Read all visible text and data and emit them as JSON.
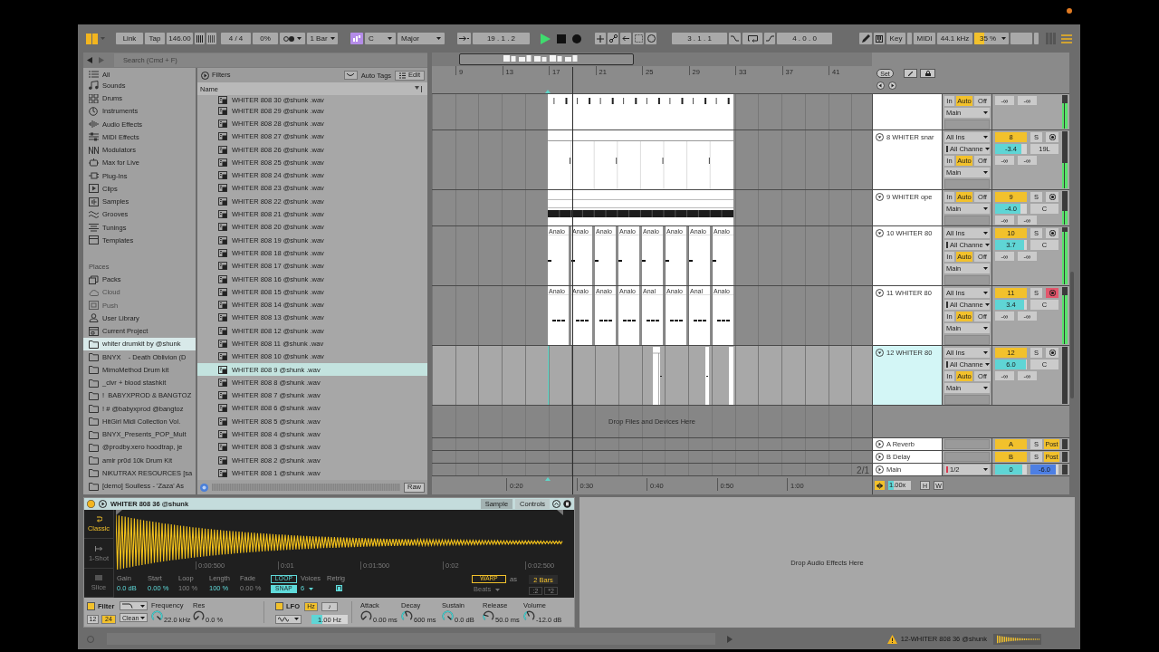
{
  "transport": {
    "link": "Link",
    "tap": "Tap",
    "tempo": "146.00",
    "time_signature": "4 / 4",
    "groove": "0%",
    "quantize": "1 Bar",
    "scale": {
      "on": true,
      "root": "C",
      "mode": "Major"
    },
    "position": "19 . 1 . 2",
    "playing": true,
    "loop_start": "3 . 1 . 1",
    "loop_length": "4 . 0 . 0",
    "key": "Key",
    "midi": "MIDI",
    "sample_rate": "44.1 kHz",
    "cpu": {
      "reading": "35 %",
      "level": 0.3
    }
  },
  "browser": {
    "search": {
      "placeholder": "Search (Cmd + F)"
    },
    "categories": [
      {
        "label": "All"
      },
      {
        "label": "Sounds"
      },
      {
        "label": "Drums"
      },
      {
        "label": "Instruments"
      },
      {
        "label": "Audio Effects"
      },
      {
        "label": "MIDI Effects"
      },
      {
        "label": "Modulators"
      },
      {
        "label": "Max for Live"
      },
      {
        "label": "Plug-Ins"
      },
      {
        "label": "Clips"
      },
      {
        "label": "Samples"
      },
      {
        "label": "Grooves"
      },
      {
        "label": "Tunings"
      },
      {
        "label": "Templates"
      }
    ],
    "places_heading": "Places",
    "places": [
      {
        "label": "Packs",
        "kind": "packs",
        "disabled": false,
        "selected": false
      },
      {
        "label": "Cloud",
        "kind": "cloud",
        "disabled": true,
        "selected": false
      },
      {
        "label": "Push",
        "kind": "push",
        "disabled": true,
        "selected": false
      },
      {
        "label": "User Library",
        "kind": "library",
        "disabled": false,
        "selected": false
      },
      {
        "label": "Current Project",
        "kind": "project",
        "disabled": false,
        "selected": false
      },
      {
        "label": "whiter drumkit by @shunk",
        "kind": "folder",
        "disabled": false,
        "selected": true
      },
      {
        "label": "BNYX    - Death Oblivion (D",
        "kind": "folder",
        "disabled": false,
        "selected": false
      },
      {
        "label": "MimoMethod Drum kit",
        "kind": "folder",
        "disabled": false,
        "selected": false
      },
      {
        "label": "_clvr + blood stashkit",
        "kind": "folder",
        "disabled": false,
        "selected": false
      },
      {
        "label": "!  BABYXPROD & BANGTOZ",
        "kind": "folder",
        "disabled": false,
        "selected": false
      },
      {
        "label": "! # @babyxprod @bangtoz",
        "kind": "folder",
        "disabled": false,
        "selected": false
      },
      {
        "label": "HitGirl Midi Collection Vol.",
        "kind": "folder",
        "disabled": false,
        "selected": false
      },
      {
        "label": "BNYX_Presents_POP_Mult",
        "kind": "folder",
        "disabled": false,
        "selected": false
      },
      {
        "label": "@prodby.xero hoodtrap, je",
        "kind": "folder",
        "disabled": false,
        "selected": false
      },
      {
        "label": "amir pr0d 10k Drum Kit",
        "kind": "folder",
        "disabled": false,
        "selected": false
      },
      {
        "label": "NiKUTRAX RESOURCES [sa",
        "kind": "folder",
        "disabled": false,
        "selected": false
      },
      {
        "label": "[demo] Soulless - 'Zaza' As",
        "kind": "folder",
        "disabled": false,
        "selected": false
      }
    ],
    "filters": "Filters",
    "auto_tags": {
      "label": "Auto Tags",
      "on": false
    },
    "edit": "Edit",
    "column": "Name",
    "files": [
      {
        "name": "WHITER 808 30 @shunk .wav",
        "selected": false
      },
      {
        "name": "WHITER 808 29 @shunk .wav",
        "selected": false
      },
      {
        "name": "WHITER 808 28 @shunk .wav",
        "selected": false
      },
      {
        "name": "WHITER 808 27 @shunk .wav",
        "selected": false
      },
      {
        "name": "WHITER 808 26 @shunk .wav",
        "selected": false
      },
      {
        "name": "WHITER 808 25 @shunk .wav",
        "selected": false
      },
      {
        "name": "WHITER 808 24 @shunk .wav",
        "selected": false
      },
      {
        "name": "WHITER 808 23 @shunk .wav",
        "selected": false
      },
      {
        "name": "WHITER 808 22 @shunk .wav",
        "selected": false
      },
      {
        "name": "WHITER 808 21 @shunk .wav",
        "selected": false
      },
      {
        "name": "WHITER 808 20 @shunk .wav",
        "selected": false
      },
      {
        "name": "WHITER 808 19 @shunk .wav",
        "selected": false
      },
      {
        "name": "WHITER 808 18 @shunk .wav",
        "selected": false
      },
      {
        "name": "WHITER 808 17 @shunk .wav",
        "selected": false
      },
      {
        "name": "WHITER 808 16 @shunk .wav",
        "selected": false
      },
      {
        "name": "WHITER 808 15 @shunk .wav",
        "selected": false
      },
      {
        "name": "WHITER 808 14 @shunk .wav",
        "selected": false
      },
      {
        "name": "WHITER 808 13 @shunk .wav",
        "selected": false
      },
      {
        "name": "WHITER 808 12 @shunk .wav",
        "selected": false
      },
      {
        "name": "WHITER 808 11 @shunk .wav",
        "selected": false
      },
      {
        "name": "WHITER 808 10 @shunk .wav",
        "selected": false
      },
      {
        "name": "WHITER 808 9 @shunk .wav",
        "selected": true
      },
      {
        "name": "WHITER 808 8 @shunk .wav",
        "selected": false
      },
      {
        "name": "WHITER 808 7 @shunk .wav",
        "selected": false
      },
      {
        "name": "WHITER 808 6 @shunk .wav",
        "selected": false
      },
      {
        "name": "WHITER 808 5 @shunk .wav",
        "selected": false
      },
      {
        "name": "WHITER 808 4 @shunk .wav",
        "selected": false
      },
      {
        "name": "WHITER 808 3 @shunk .wav",
        "selected": false
      },
      {
        "name": "WHITER 808 2 @shunk .wav",
        "selected": false
      },
      {
        "name": "WHITER 808 1 @shunk .wav",
        "selected": false
      }
    ],
    "raw": "Raw"
  },
  "arrangement": {
    "set": "Set",
    "bars": [
      "9",
      "13",
      "17",
      "21",
      "25",
      "29",
      "33",
      "37",
      "41"
    ],
    "tracks": [
      {
        "selected": false,
        "monitor": [
          {
            "label": "In",
            "selected": false
          },
          {
            "label": "Auto",
            "selected": true
          },
          {
            "label": "Off",
            "selected": false
          }
        ],
        "output": "Main",
        "peaks": [
          "-∞",
          "-∞"
        ],
        "meter": {
          "level": 0.75
        },
        "lane": {
          "kind": "hits"
        }
      },
      {
        "name": "8 WHITER snar",
        "number": "8",
        "solo": "S",
        "armed": false,
        "selected": false,
        "input": "All Ins",
        "channel": "All Channe",
        "monitor": [
          {
            "label": "In",
            "selected": false
          },
          {
            "label": "Auto",
            "selected": true
          },
          {
            "label": "Off",
            "selected": false
          }
        ],
        "output": "Main",
        "volume": {
          "reading": "-3.4",
          "level": 0.82
        },
        "pan": "19L",
        "peaks": [
          "-∞",
          "-∞"
        ],
        "meter": {
          "level": 0.45
        },
        "lane": {
          "kind": "sparse"
        }
      },
      {
        "name": "9 WHITER ope",
        "number": "9",
        "solo": "S",
        "armed": false,
        "selected": false,
        "monitor": [
          {
            "label": "In",
            "selected": false
          },
          {
            "label": "Auto",
            "selected": true
          },
          {
            "label": "Off",
            "selected": false
          }
        ],
        "output": "Main",
        "volume": {
          "reading": "-4.0",
          "level": 0.8
        },
        "pan": "C",
        "peaks": [
          "-∞",
          "-∞"
        ],
        "meter": {
          "level": 0.4
        },
        "lane": {
          "kind": "bar"
        }
      },
      {
        "name": "10 WHITER 80",
        "number": "10",
        "solo": "S",
        "armed": false,
        "selected": false,
        "input": "All Ins",
        "channel": "All Channe",
        "monitor": [
          {
            "label": "In",
            "selected": false
          },
          {
            "label": "Auto",
            "selected": true
          },
          {
            "label": "Off",
            "selected": false
          }
        ],
        "output": "Main",
        "volume": {
          "reading": "3.7",
          "level": 0.92
        },
        "pan": "C",
        "peaks": [
          "-∞",
          "-∞"
        ],
        "meter": {
          "level": 0.92
        },
        "lane": {
          "kind": "note-clips",
          "clips": [
            {
              "name": "Analo"
            },
            {
              "name": "Analo"
            },
            {
              "name": "Analo"
            },
            {
              "name": "Analo"
            },
            {
              "name": "Analo"
            },
            {
              "name": "Analo"
            },
            {
              "name": "Analo"
            },
            {
              "name": "Analo"
            }
          ]
        }
      },
      {
        "name": "11 WHITER 80",
        "number": "11",
        "solo": "S",
        "armed": true,
        "selected": false,
        "input": "All Ins",
        "channel": "All Channe",
        "monitor": [
          {
            "label": "In",
            "selected": false
          },
          {
            "label": "Auto",
            "selected": true
          },
          {
            "label": "Off",
            "selected": false
          }
        ],
        "output": "Main",
        "volume": {
          "reading": "3.4",
          "level": 0.9
        },
        "pan": "C",
        "peaks": [
          "-∞",
          "-∞"
        ],
        "meter": {
          "level": 0.85
        },
        "lane": {
          "kind": "chord-clips",
          "clips": [
            {
              "name": "Analo"
            },
            {
              "name": "Analo"
            },
            {
              "name": "Analo"
            },
            {
              "name": "Analo"
            },
            {
              "name": "Anal"
            },
            {
              "name": "Analo"
            },
            {
              "name": "Anal"
            },
            {
              "name": "Analo"
            }
          ]
        }
      },
      {
        "name": "12 WHITER 80",
        "number": "12",
        "solo": "S",
        "armed": false,
        "selected": true,
        "input": "All Ins",
        "channel": "All Channe",
        "monitor": [
          {
            "label": "In",
            "selected": false
          },
          {
            "label": "Auto",
            "selected": true
          },
          {
            "label": "Off",
            "selected": false
          }
        ],
        "output": "Main",
        "volume": {
          "reading": "6.0",
          "level": 0.96
        },
        "pan": "C",
        "peaks": [
          "-∞",
          "-∞"
        ],
        "lane": {
          "kind": "fragments"
        }
      }
    ],
    "drop_hint": "Drop Files and Devices Here",
    "returns": [
      {
        "name": "A Reverb",
        "letter": "A",
        "solo": "S",
        "post": "Post"
      },
      {
        "name": "B Delay",
        "letter": "B",
        "solo": "S",
        "post": "Post"
      }
    ],
    "main": {
      "name": "Main",
      "output": "1/2",
      "volume": {
        "reading": "0",
        "level": 0.85
      },
      "cue": {
        "reading": "-6.0",
        "level": 0.9
      }
    },
    "grid": "2/1",
    "times": [
      "0:20",
      "0:30",
      "0:40",
      "0:50",
      "1:00"
    ],
    "zoom": "1.00x",
    "height_toggle": "H",
    "width_toggle": "W"
  },
  "device": {
    "title": "WHITER 808 36 @shunk",
    "on": true,
    "tabs": [
      {
        "label": "Sample",
        "selected": true
      },
      {
        "label": "Controls",
        "selected": false
      }
    ],
    "modes": [
      {
        "label": "Classic",
        "selected": true
      },
      {
        "label": "1-Shot",
        "selected": false
      },
      {
        "label": "Slice",
        "selected": false
      }
    ],
    "time_ruler": [
      "0:00:500",
      "0:01",
      "0:01:500",
      "0:02",
      "0:02:500"
    ],
    "params": [
      {
        "label": "Gain",
        "value": "0.0 dB",
        "disabled": false
      },
      {
        "label": "Start",
        "value": "0.00 %",
        "disabled": false
      },
      {
        "label": "Loop",
        "value": "100 %",
        "disabled": true
      },
      {
        "label": "Length",
        "value": "100 %",
        "disabled": false
      },
      {
        "label": "Fade",
        "value": "0.00 %",
        "disabled": true
      }
    ],
    "loop": {
      "label": "LOOP",
      "on": false
    },
    "snap": {
      "label": "SNAP",
      "on": true
    },
    "voices": {
      "label": "Voices",
      "value": "6"
    },
    "retrig": {
      "label": "Retrig",
      "checked": true
    },
    "warp": {
      "label": "WARP",
      "on": false
    },
    "warp_as": "as",
    "warp_length": "2 Bars",
    "warp_mode": "Beats",
    "halve": ":2",
    "double": "*2",
    "filter": {
      "label": "Filter",
      "on": true,
      "slopes": [
        {
          "label": "12",
          "selected": false
        },
        {
          "label": "24",
          "selected": true
        }
      ],
      "circuit": "Clean",
      "frequency": {
        "label": "Frequency",
        "value": "22.0 kHz",
        "level": 1
      },
      "resonance": {
        "label": "Res",
        "value": "0.0 %"
      }
    },
    "lfo": {
      "label": "LFO",
      "on": true,
      "units": [
        {
          "label": "Hz",
          "selected": true
        },
        {
          "label": "♪",
          "selected": false
        }
      ],
      "rate": {
        "reading": "1.00 Hz",
        "level": 0.3
      }
    },
    "envelope": [
      {
        "label": "Attack",
        "value": "0.00 ms"
      },
      {
        "label": "Decay",
        "value": "600 ms",
        "level": 0.42
      },
      {
        "label": "Sustain",
        "value": "0.0 dB",
        "level": 1
      },
      {
        "label": "Release",
        "value": "50.0 ms",
        "level": 0.22
      },
      {
        "label": "Volume",
        "value": "-12.0 dB",
        "level": 0.4
      }
    ]
  },
  "effects_drop": "Drop Audio Effects Here",
  "status_bar": {
    "message": "12-WHITER 808 36 @shunk"
  }
}
